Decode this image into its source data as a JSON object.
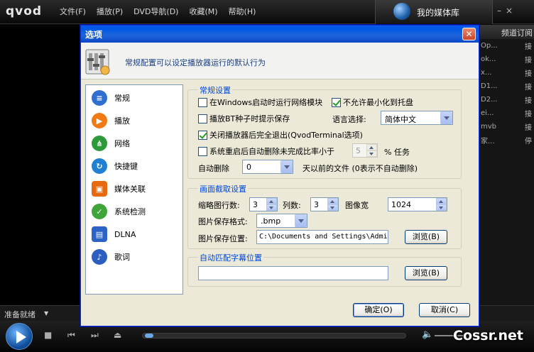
{
  "app": {
    "logo": "qvod",
    "menu": [
      "文件(F)",
      "播放(P)",
      "DVD导航(D)",
      "收藏(M)",
      "帮助(H)"
    ],
    "library_label": "我的媒体库",
    "status": "准备就绪",
    "right_panel": {
      "header": "频道订阅",
      "rows": [
        {
          "a": "Op...",
          "b": "接"
        },
        {
          "a": "ok...",
          "b": "接"
        },
        {
          "a": "x...",
          "b": "接"
        },
        {
          "a": "D1...",
          "b": "接"
        },
        {
          "a": "D2...",
          "b": "接"
        },
        {
          "a": "ei...",
          "b": "接"
        },
        {
          "a": "mvb",
          "b": "接"
        },
        {
          "a": "家...",
          "b": "停"
        }
      ]
    },
    "watermark": "Cossr.net",
    "seek_progress": 0.0
  },
  "dialog": {
    "title": "选项",
    "close": "✕",
    "header_text": "常规配置可以设定播放器运行的默认行为",
    "nav": [
      {
        "label": "常规",
        "icon": "list-icon",
        "color": "#2f6fd0"
      },
      {
        "label": "播放",
        "icon": "play-icon",
        "color": "#f07a14"
      },
      {
        "label": "网络",
        "icon": "network-icon",
        "color": "#2c9a3a"
      },
      {
        "label": "快捷键",
        "icon": "shortcut-icon",
        "color": "#1f7fd0"
      },
      {
        "label": "媒体关联",
        "icon": "media-association-icon",
        "color": "#e86a10"
      },
      {
        "label": "系统检测",
        "icon": "system-check-icon",
        "color": "#3fa43a"
      },
      {
        "label": "DLNA",
        "icon": "dlna-icon",
        "color": "#2b63c6"
      },
      {
        "label": "歌词",
        "icon": "lyrics-icon",
        "color": "#2a5fc0"
      }
    ],
    "general": {
      "title": "常规设置",
      "run_network_module": {
        "label": "在Windows启动时运行网络模块",
        "checked": false
      },
      "no_minimize_tray": {
        "label": "不允许最小化到托盘",
        "checked": true
      },
      "bt_seed_prompt": {
        "label": "播放BT种子时提示保存",
        "checked": false
      },
      "language_label": "语言选择:",
      "language_value": "简体中文",
      "exit_fully": {
        "label": "关闭播放器后完全退出(QvodTerminal选项)",
        "checked": true
      },
      "auto_delete_restart": {
        "label": "系统重启后自动删除未完成比率小于",
        "checked": false
      },
      "ratio_value": "5",
      "ratio_suffix": "% 任务",
      "auto_delete_label": "自动删除",
      "auto_delete_value": "0",
      "auto_delete_suffix": "天以前的文件 (0表示不自动删除)"
    },
    "capture": {
      "title": "画面截取设置",
      "thumb_count_label": "缩略图行数:",
      "thumb_count_value": "3",
      "cols_label": "列数:",
      "cols_value": "3",
      "width_label": "图像宽",
      "width_value": "1024",
      "format_label": "图片保存格式:",
      "format_value": ".bmp",
      "location_label": "图片保存位置:",
      "location_value": "C:\\Documents and Settings\\Admi",
      "browse": "浏览(B)"
    },
    "subtitle": {
      "title": "自动匹配字幕位置",
      "value": "",
      "browse": "浏览(B)"
    },
    "ok": "确定(O)",
    "cancel": "取消(C)"
  }
}
